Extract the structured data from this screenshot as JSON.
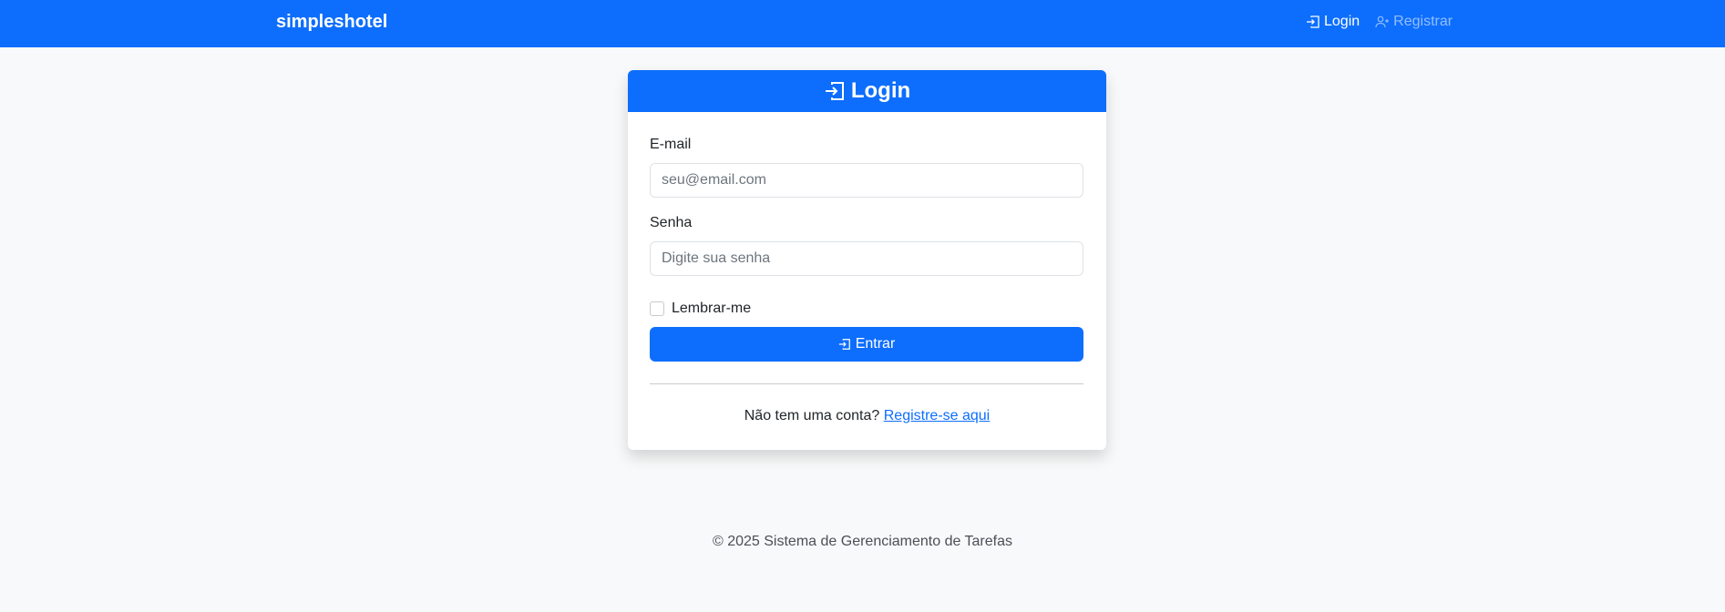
{
  "navbar": {
    "brand": "simpleshotel",
    "links": [
      {
        "label": "Login",
        "icon": "login-icon"
      },
      {
        "label": "Registrar",
        "icon": "person-plus-icon"
      }
    ]
  },
  "login_card": {
    "title": "Login",
    "email": {
      "label": "E-mail",
      "placeholder": "seu@email.com",
      "value": ""
    },
    "password": {
      "label": "Senha",
      "placeholder": "Digite sua senha",
      "value": ""
    },
    "remember": {
      "label": "Lembrar-me",
      "checked": false
    },
    "submit_label": "Entrar",
    "register_prompt": "Não tem uma conta?",
    "register_link": "Registre-se aqui"
  },
  "footer": {
    "text": "© 2025 Sistema de Gerenciamento de Tarefas"
  },
  "colors": {
    "primary": "#0d6efd",
    "background": "#f8f9fa"
  }
}
